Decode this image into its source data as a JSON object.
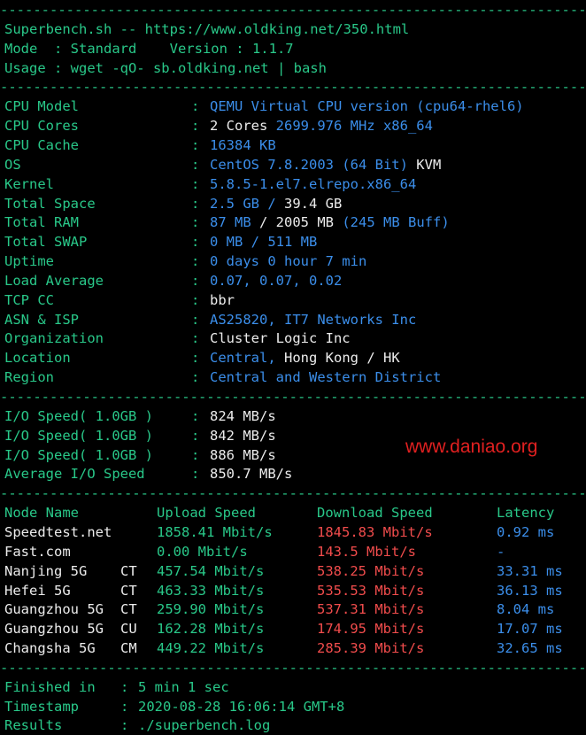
{
  "header": {
    "title": "Superbench.sh -- https://www.oldking.net/350.html",
    "mode": "Mode  : Standard    Version : 1.1.7",
    "usage": "Usage : wget -qO- sb.oldking.net | bash"
  },
  "separator": "--------------------------------------------------------------------------",
  "system": [
    {
      "label": "CPU Model",
      "parts": [
        {
          "t": "QEMU Virtual CPU version (cpu64-rhel6)",
          "c": "b"
        }
      ]
    },
    {
      "label": "CPU Cores",
      "parts": [
        {
          "t": "2 Cores ",
          "c": "w"
        },
        {
          "t": "2699.976 MHz x86_64",
          "c": "b"
        }
      ]
    },
    {
      "label": "CPU Cache",
      "parts": [
        {
          "t": "16384 KB",
          "c": "b"
        }
      ]
    },
    {
      "label": "OS",
      "parts": [
        {
          "t": "CentOS 7.8.2003 (64 Bit) ",
          "c": "b"
        },
        {
          "t": "KVM",
          "c": "w"
        }
      ]
    },
    {
      "label": "Kernel",
      "parts": [
        {
          "t": "5.8.5-1.el7.elrepo.x86_64",
          "c": "b"
        }
      ]
    },
    {
      "label": "Total Space",
      "parts": [
        {
          "t": "2.5 GB / ",
          "c": "b"
        },
        {
          "t": "39.4 GB",
          "c": "w"
        }
      ]
    },
    {
      "label": "Total RAM",
      "parts": [
        {
          "t": "87 MB",
          "c": "b"
        },
        {
          "t": " / ",
          "c": "w"
        },
        {
          "t": "2005 MB",
          "c": "w"
        },
        {
          "t": " (245 MB Buff)",
          "c": "b"
        }
      ]
    },
    {
      "label": "Total SWAP",
      "parts": [
        {
          "t": "0 MB / 511 MB",
          "c": "b"
        }
      ]
    },
    {
      "label": "Uptime",
      "parts": [
        {
          "t": "0 days 0 hour 7 min",
          "c": "b"
        }
      ]
    },
    {
      "label": "Load Average",
      "parts": [
        {
          "t": "0.07, 0.07, 0.02",
          "c": "b"
        }
      ]
    },
    {
      "label": "TCP CC",
      "parts": [
        {
          "t": "bbr",
          "c": "w"
        }
      ]
    },
    {
      "label": "ASN & ISP",
      "parts": [
        {
          "t": "AS25820, IT7 Networks Inc",
          "c": "b"
        }
      ]
    },
    {
      "label": "Organization",
      "parts": [
        {
          "t": "Cluster Logic Inc",
          "c": "w"
        }
      ]
    },
    {
      "label": "Location",
      "parts": [
        {
          "t": "Central, ",
          "c": "b"
        },
        {
          "t": "Hong Kong / HK",
          "c": "w"
        }
      ]
    },
    {
      "label": "Region",
      "parts": [
        {
          "t": "Central and Western District",
          "c": "b"
        }
      ]
    }
  ],
  "io": [
    {
      "label": "I/O Speed( 1.0GB )",
      "value": "824 MB/s"
    },
    {
      "label": "I/O Speed( 1.0GB )",
      "value": "842 MB/s"
    },
    {
      "label": "I/O Speed( 1.0GB )",
      "value": "886 MB/s"
    },
    {
      "label": "Average I/O Speed",
      "value": "850.7 MB/s"
    }
  ],
  "watermark": "www.daniao.org",
  "speedtest": {
    "headers": [
      "Node Name",
      "Upload Speed",
      "Download Speed",
      "Latency"
    ],
    "rows": [
      {
        "node": "Speedtest.net",
        "isp": "",
        "up": "1858.41 Mbit/s",
        "down": "1845.83 Mbit/s",
        "lat": "0.92 ms"
      },
      {
        "node": "Fast.com",
        "isp": "",
        "up": "0.00 Mbit/s",
        "down": "143.5 Mbit/s",
        "lat": "-"
      },
      {
        "node": "Nanjing 5G",
        "isp": "CT",
        "up": "457.54 Mbit/s",
        "down": "538.25 Mbit/s",
        "lat": "33.31 ms"
      },
      {
        "node": "Hefei 5G",
        "isp": "CT",
        "up": "463.33 Mbit/s",
        "down": "535.53 Mbit/s",
        "lat": "36.13 ms"
      },
      {
        "node": "Guangzhou 5G",
        "isp": "CT",
        "up": "259.90 Mbit/s",
        "down": "537.31 Mbit/s",
        "lat": "8.04 ms"
      },
      {
        "node": "Guangzhou 5G",
        "isp": "CU",
        "up": "162.28 Mbit/s",
        "down": "174.95 Mbit/s",
        "lat": "17.07 ms"
      },
      {
        "node": "Changsha 5G",
        "isp": "CM",
        "up": "449.22 Mbit/s",
        "down": "285.39 Mbit/s",
        "lat": "32.65 ms"
      }
    ]
  },
  "footer": [
    {
      "label": "Finished in",
      "value": "5 min 1 sec"
    },
    {
      "label": "Timestamp",
      "value": "2020-08-28 16:06:14 GMT+8"
    },
    {
      "label": "Results",
      "value": "./superbench.log"
    }
  ]
}
